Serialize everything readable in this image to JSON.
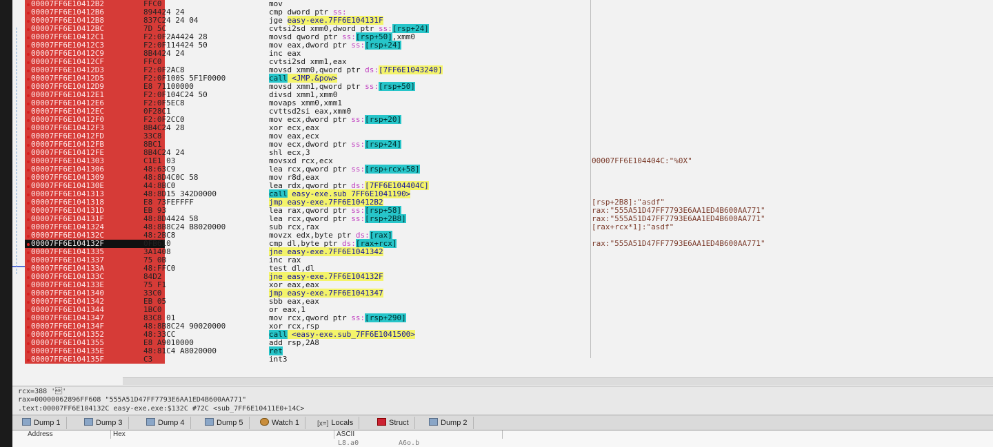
{
  "addresses": [
    "00007FF6E10412B2",
    "00007FF6E10412B6",
    "00007FF6E10412B8",
    "00007FF6E10412BC",
    "00007FF6E10412C1",
    "00007FF6E10412C3",
    "00007FF6E10412C9",
    "00007FF6E10412CF",
    "00007FF6E10412D3",
    "00007FF6E10412D5",
    "00007FF6E10412D9",
    "00007FF6E10412E1",
    "00007FF6E10412E6",
    "00007FF6E10412EC",
    "00007FF6E10412F0",
    "00007FF6E10412F3",
    "00007FF6E10412FD",
    "00007FF6E10412FB",
    "00007FF6E10412FE",
    "00007FF6E1041303",
    "00007FF6E1041306",
    "00007FF6E1041309",
    "00007FF6E104130E",
    "00007FF6E1041313",
    "00007FF6E1041318",
    "00007FF6E104131D",
    "00007FF6E104131F",
    "00007FF6E1041324",
    "00007FF6E104132C",
    "00007FF6E104132F",
    "00007FF6E1041335",
    "00007FF6E1041337",
    "00007FF6E104133A",
    "00007FF6E104133C",
    "00007FF6E104133E",
    "00007FF6E1041340",
    "00007FF6E1041342",
    "00007FF6E1041344",
    "00007FF6E1041347",
    "00007FF6E104134F",
    "00007FF6E1041352",
    "00007FF6E1041355",
    "00007FF6E104135E",
    "00007FF6E104135F"
  ],
  "bytes": [
    "FFC0",
    "894424 24",
    "837C24 24 04",
    "7D 5C",
    "F2:0F2A4424 28",
    "F2:0F114424 50",
    "8B4424 24",
    "FFC0",
    "F2:0F2AC8",
    "F2:0F100S 5F1F0000",
    "E8 71100000",
    "F2:0F104C24 50",
    "F2:0F5EC8",
    "0F28C1",
    "F2:0F2CC0",
    "8B4C24 28",
    "33C8",
    "8BC1",
    "8B4C24 24",
    "C1E1 03",
    "48:63C9",
    "48:8D4C0C 58",
    "44:8BC0",
    "48:8D15 342D0000",
    "E8 73FEFFFF",
    "EB 93",
    "48:8D4424 58",
    "48:8B8C24 B8020000",
    "48:2BC8",
    "0FB610",
    "3A1408",
    "75 0B",
    "48:FFC0",
    "84D2",
    "75 F1",
    "33C0",
    "EB 05",
    "1BC0",
    "83C8 01",
    "48:8B8C24 90020000",
    "48:33CC",
    "E8 A9010000",
    "48:81C4 A8020000",
    "C3",
    "CC"
  ],
  "disasm": [
    {
      "t": "mov"
    },
    {
      "t": "cmp dword ptr ",
      "a": "ss:"
    },
    {
      "t": "jge ",
      "h": "easy-exe.7FF6E104131F"
    },
    {
      "t": "cvtsi2sd xmm0,dword ptr ",
      "a": "ss:",
      "c": "[rsp+24]"
    },
    {
      "t": "movsd qword ptr ",
      "a": "ss:",
      "c": "[rsp+50]",
      "r": ",xmm0"
    },
    {
      "t": "mov eax,dword ptr ",
      "a": "ss:",
      "c": "[rsp+24]"
    },
    {
      "t": "inc eax"
    },
    {
      "t": "cvtsi2sd xmm1,eax"
    },
    {
      "t": "movsd xmm0,qword ptr ",
      "a": "ds:",
      "h": "[7FF6E1043240]"
    },
    {
      "t": "",
      "cy": "call",
      "h": " <JMP.&pow>"
    },
    {
      "t": "movsd xmm1,qword ptr ",
      "a": "ss:",
      "c": "[rsp+50]"
    },
    {
      "t": "divsd xmm1,xmm0"
    },
    {
      "t": "movaps xmm0,xmm1"
    },
    {
      "t": "cvttsd2si eax,xmm0"
    },
    {
      "t": "mov ecx,dword ptr ",
      "a": "ss:",
      "c": "[rsp+20]"
    },
    {
      "t": "xor ecx,eax"
    },
    {
      "t": "mov eax,ecx"
    },
    {
      "t": "mov ecx,dword ptr ",
      "a": "ss:",
      "c": "[rsp+24]"
    },
    {
      "t": "shl ecx,3"
    },
    {
      "t": "movsxd rcx,ecx"
    },
    {
      "t": "lea rcx,qword ptr ",
      "a": "ss:",
      "c": "[rsp+rcx+58]"
    },
    {
      "t": "mov r8d,eax"
    },
    {
      "t": "lea rdx,qword ptr ",
      "a": "ds:",
      "h": "[7FF6E104404C]"
    },
    {
      "t": "",
      "cy": "call",
      "h": " easy-exe.sub_7FF6E1041190>"
    },
    {
      "t": "",
      "h": "jmp easy-exe.7FF6E10412B2"
    },
    {
      "t": "lea rax,qword ptr ",
      "a": "ss:",
      "c": "[rsp+58]"
    },
    {
      "t": "lea rcx,qword ptr ",
      "a": "ss:",
      "c": "[rsp+2B8]"
    },
    {
      "t": "sub rcx,rax"
    },
    {
      "t": "movzx edx,byte ptr ",
      "a": "ds:",
      "c": "[rax]"
    },
    {
      "t": "cmp dl,byte ptr ",
      "a": "ds:",
      "c": "[rax+rcx]"
    },
    {
      "t": "",
      "h": "jne easy-exe.7FF6E1041342"
    },
    {
      "t": "inc rax"
    },
    {
      "t": "test dl,dl"
    },
    {
      "t": "",
      "h": "jne easy-exe.7FF6E104132F"
    },
    {
      "t": "xor eax,eax"
    },
    {
      "t": "",
      "h": "jmp easy-exe.7FF6E1041347"
    },
    {
      "t": "sbb eax,eax"
    },
    {
      "t": "or eax,1"
    },
    {
      "t": "mov rcx,qword ptr ",
      "a": "ss:",
      "c": "[rsp+290]"
    },
    {
      "t": "xor rcx,rsp"
    },
    {
      "t": "",
      "cy": "call",
      "h": " <easy-exe.sub_7FF6E1041500>"
    },
    {
      "t": "add rsp,2A8"
    },
    {
      "t": "",
      "cy": "ret"
    },
    {
      "t": "int3"
    }
  ],
  "comments": [
    {
      "row": 19,
      "text": "00007FF6E104404C:\"%0X\""
    },
    {
      "row": 24,
      "text": "[rsp+2B8]:\"asdf\""
    },
    {
      "row": 25,
      "text": "rax:\"555A51D47FF7793E6AA1ED4B600AA771\""
    },
    {
      "row": 26,
      "text": "rax:\"555A51D47FF7793E6AA1ED4B600AA771\""
    },
    {
      "row": 27,
      "text": "[rax+rcx*1]:\"asdf\""
    },
    {
      "row": 29,
      "text": "rax:\"555A51D47FF7793E6AA1ED4B600AA771\""
    }
  ],
  "selected_row": 29,
  "info": {
    "line1": "rcx=388 '\u0006'",
    "line2": "rax=00000062896FF608 \"555A51D47FF7793E6AA1ED4B600AA771\"",
    "line3": ".text:00007FF6E104132C easy-exe.exe:$132C #72C <sub_7FF6E10411E0+14C>"
  },
  "tabs": [
    "Dump 1",
    "Dump 3",
    "Dump 4",
    "Dump 5",
    "Watch 1",
    "Locals",
    "Struct",
    "Dump 2"
  ],
  "dump": {
    "col_address": "Address",
    "col_hex": "Hex",
    "col_ascii": "ASCII",
    "ascii_row1": "L8.a0",
    "ascii_row2": "A6o.b"
  },
  "colors": {
    "breakpoint": "#d63b37",
    "highlight": "#f4f46a",
    "cyan": "#27c5c9"
  }
}
